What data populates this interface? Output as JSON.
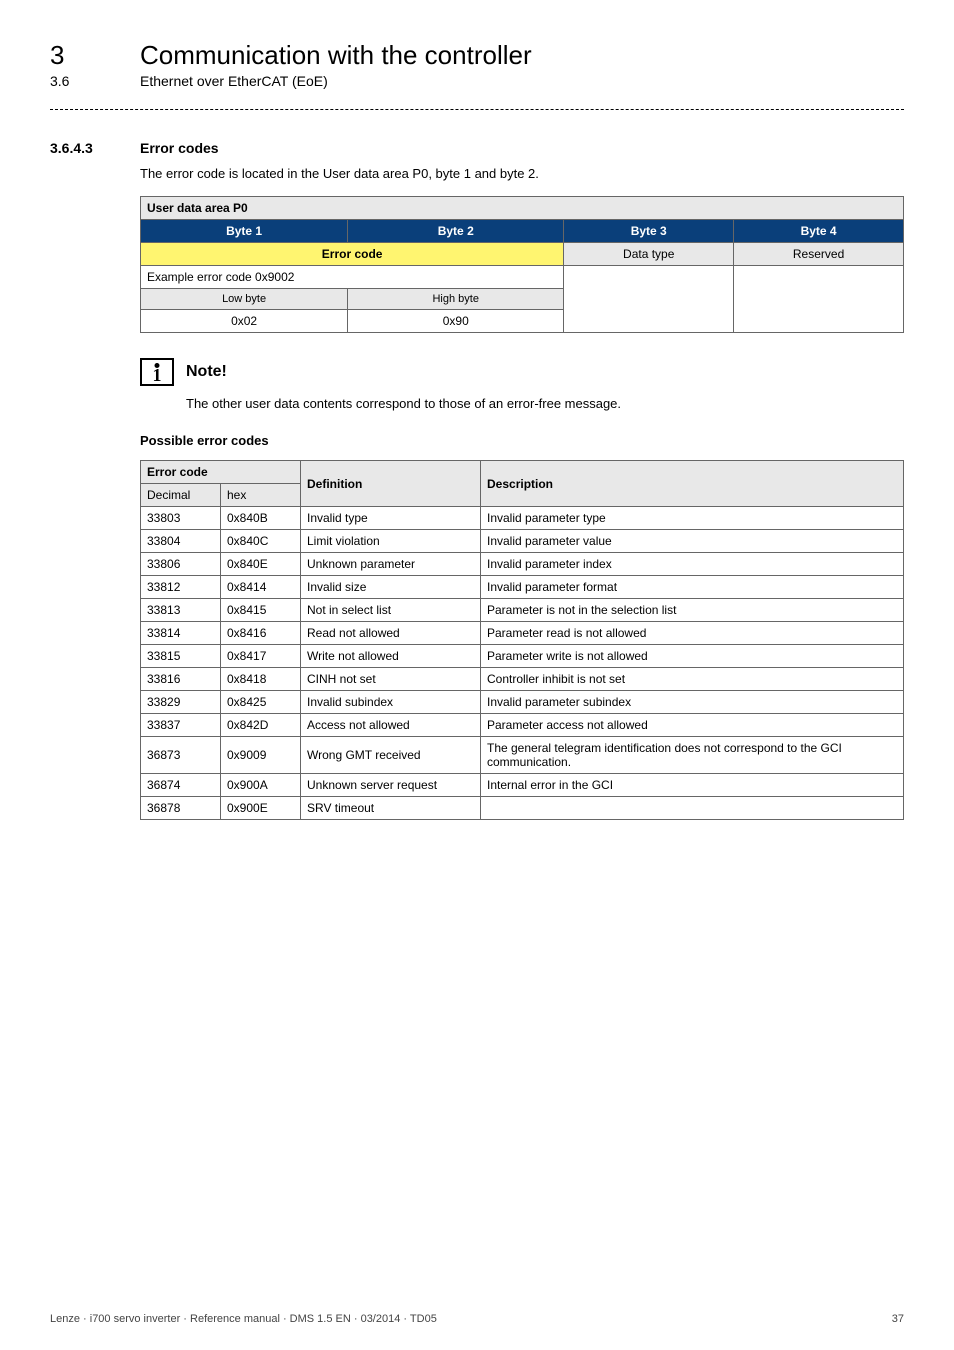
{
  "chapter": {
    "num": "3",
    "title": "Communication with the controller"
  },
  "subsection": {
    "num": "3.6",
    "title": "Ethernet over EtherCAT (EoE)"
  },
  "section": {
    "num": "3.6.4.3",
    "title": "Error codes"
  },
  "intro": "The error code is located in the User data area P0, byte 1 and byte 2.",
  "table1": {
    "header": "User data area P0",
    "bytes": {
      "b1": "Byte 1",
      "b2": "Byte 2",
      "b3": "Byte 3",
      "b4": "Byte 4"
    },
    "errcode": "Error code",
    "datatype": "Data type",
    "reserved": "Reserved",
    "example": "Example error code 0x9002",
    "low": "Low byte",
    "high": "High byte",
    "v1": "0x02",
    "v2": "0x90"
  },
  "note": {
    "label": "Note!",
    "text": "The other user data contents correspond to those of an error-free message."
  },
  "possible": "Possible error codes",
  "table2": {
    "h_errcode": "Error code",
    "h_def": "Definition",
    "h_desc": "Description",
    "h_dec": "Decimal",
    "h_hex": "hex",
    "rows": [
      {
        "dec": "33803",
        "hex": "0x840B",
        "def": "Invalid type",
        "desc": "Invalid parameter type"
      },
      {
        "dec": "33804",
        "hex": "0x840C",
        "def": "Limit violation",
        "desc": "Invalid parameter value"
      },
      {
        "dec": "33806",
        "hex": "0x840E",
        "def": "Unknown parameter",
        "desc": "Invalid parameter index"
      },
      {
        "dec": "33812",
        "hex": "0x8414",
        "def": "Invalid size",
        "desc": "Invalid parameter format"
      },
      {
        "dec": "33813",
        "hex": "0x8415",
        "def": "Not in select list",
        "desc": "Parameter is not in the selection list"
      },
      {
        "dec": "33814",
        "hex": "0x8416",
        "def": "Read not allowed",
        "desc": "Parameter read is not allowed"
      },
      {
        "dec": "33815",
        "hex": "0x8417",
        "def": "Write not allowed",
        "desc": "Parameter write is not allowed"
      },
      {
        "dec": "33816",
        "hex": "0x8418",
        "def": "CINH not set",
        "desc": "Controller inhibit is not set"
      },
      {
        "dec": "33829",
        "hex": "0x8425",
        "def": "Invalid subindex",
        "desc": "Invalid parameter subindex"
      },
      {
        "dec": "33837",
        "hex": "0x842D",
        "def": "Access not allowed",
        "desc": "Parameter access not allowed"
      },
      {
        "dec": "36873",
        "hex": "0x9009",
        "def": "Wrong GMT received",
        "desc": "The general telegram identification does not correspond to the GCI communication."
      },
      {
        "dec": "36874",
        "hex": "0x900A",
        "def": "Unknown server request",
        "desc": "Internal error in the GCI"
      },
      {
        "dec": "36878",
        "hex": "0x900E",
        "def": "SRV timeout",
        "desc": ""
      }
    ]
  },
  "footer": {
    "left": "Lenze · i700 servo inverter · Reference manual · DMS 1.5 EN · 03/2014 · TD05",
    "right": "37"
  }
}
